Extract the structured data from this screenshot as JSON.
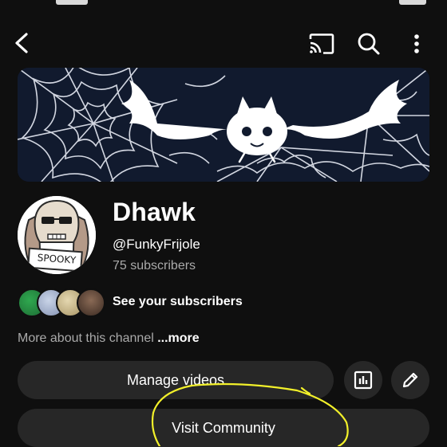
{
  "channel": {
    "name": "Dhawk",
    "handle": "@FunkyFrijole",
    "subscribers": "75 subscribers",
    "avatar_text": "SPOOKY"
  },
  "subscribers_row": {
    "label": "See your subscribers"
  },
  "about": {
    "text": "More about this channel ",
    "more_link": "...more"
  },
  "actions": {
    "manage_videos": "Manage videos",
    "visit_community": "Visit Community"
  },
  "icons": {
    "back": "back-arrow-icon",
    "cast": "cast-icon",
    "search": "search-icon",
    "menu": "more-vert-icon",
    "analytics": "analytics-icon",
    "edit": "pencil-icon"
  },
  "colors": {
    "background": "#0f0f0f",
    "pill": "#272727",
    "secondary_text": "#aaaaaa",
    "highlight_annotation": "#f2f02a",
    "banner": "#111a2e"
  }
}
